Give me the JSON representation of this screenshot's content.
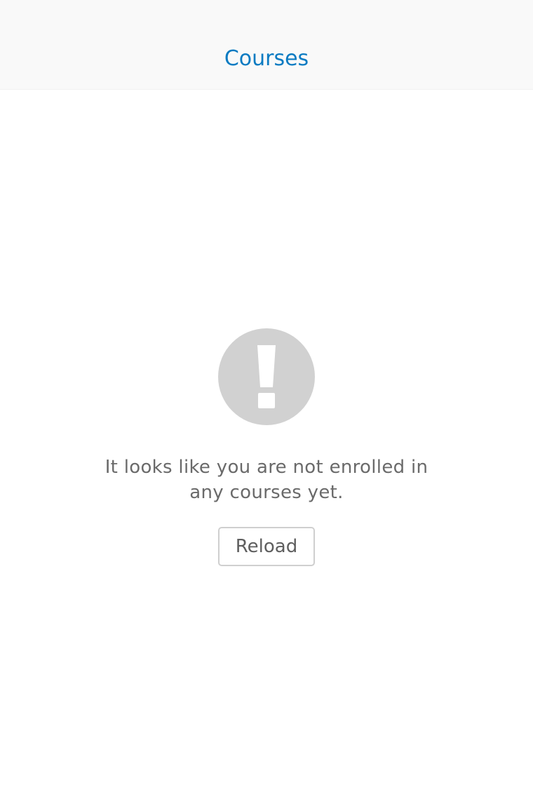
{
  "header": {
    "title": "Courses"
  },
  "empty_state": {
    "icon": "exclamation-circle-icon",
    "message": "It looks like you are not enrolled in any courses yet.",
    "reload_label": "Reload"
  },
  "colors": {
    "title": "#0a7bc2",
    "icon": "#d1d1d1",
    "message_text": "#6a6a6a",
    "button_border": "#cfcfcf"
  }
}
